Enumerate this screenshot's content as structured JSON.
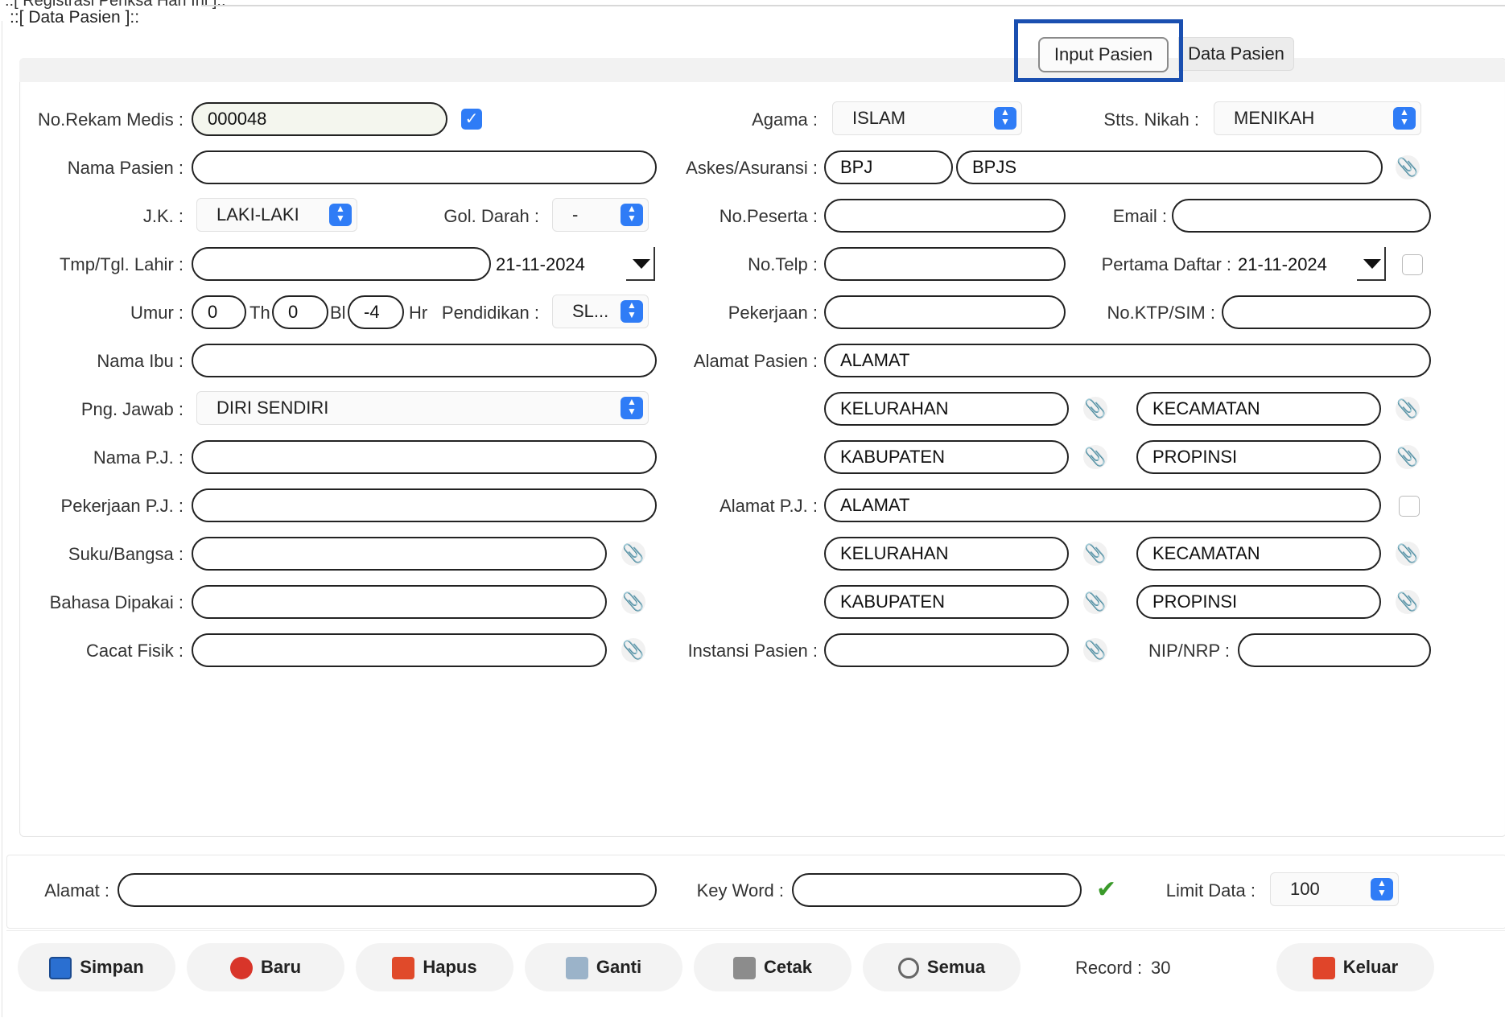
{
  "window": {
    "frame_title": "::[ Registrasi Periksa Hari Ini ]::",
    "section_title": "::[ Data Pasien ]::"
  },
  "tabs": [
    {
      "label": "Input Pasien",
      "active": true
    },
    {
      "label": "Data Pasien",
      "active": false
    }
  ],
  "left": {
    "no_rm_label": "No.Rekam Medis :",
    "no_rm_value": "000048",
    "no_rm_checked": true,
    "nama_label": "Nama Pasien :",
    "nama_value": "",
    "jk_label": "J.K. :",
    "jk_value": "LAKI-LAKI",
    "goldarah_label": "Gol. Darah :",
    "goldarah_value": "-",
    "tmp_label": "Tmp/Tgl. Lahir :",
    "tmp_value": "",
    "tgl_lahir": "21-11-2024",
    "umur_label": "Umur :",
    "umur_th": "0",
    "th_label": "Th",
    "umur_bl": "0",
    "bl_label": "Bl",
    "umur_hr": "-4",
    "hr_label": "Hr",
    "pendidikan_label": "Pendidikan :",
    "pendidikan_value": "SL...",
    "ibu_label": "Nama Ibu :",
    "ibu_value": "",
    "pj_label": "Png. Jawab :",
    "pj_value": "DIRI SENDIRI",
    "namapj_label": "Nama P.J. :",
    "namapj_value": "",
    "pekerjaanpj_label": "Pekerjaan P.J. :",
    "pekerjaanpj_value": "",
    "suku_label": "Suku/Bangsa :",
    "suku_value": "",
    "bahasa_label": "Bahasa Dipakai :",
    "bahasa_value": "",
    "cacat_label": "Cacat Fisik :",
    "cacat_value": ""
  },
  "right": {
    "agama_label": "Agama :",
    "agama_value": "ISLAM",
    "nikah_label": "Stts. Nikah :",
    "nikah_value": "MENIKAH",
    "askes_label": "Askes/Asuransi :",
    "askes_code": "BPJ",
    "askes_name": "BPJS",
    "peserta_label": "No.Peserta :",
    "peserta_value": "",
    "email_label": "Email :",
    "email_value": "",
    "telp_label": "No.Telp :",
    "telp_value": "",
    "daftar_label": "Pertama Daftar :",
    "daftar_value": "21-11-2024",
    "pekerjaan_label": "Pekerjaan :",
    "pekerjaan_value": "",
    "ktp_label": "No.KTP/SIM :",
    "ktp_value": "",
    "alamat_label": "Alamat Pasien :",
    "alamat_value": "ALAMAT",
    "kel1": "KELURAHAN",
    "kec1": "KECAMATAN",
    "kab1": "KABUPATEN",
    "prop1": "PROPINSI",
    "alamatpj_label": "Alamat P.J. :",
    "alamatpj_value": "ALAMAT",
    "kel2": "KELURAHAN",
    "kec2": "KECAMATAN",
    "kab2": "KABUPATEN",
    "prop2": "PROPINSI",
    "instansi_label": "Instansi Pasien :",
    "instansi_value": "",
    "nip_label": "NIP/NRP :",
    "nip_value": ""
  },
  "search": {
    "alamat_label": "Alamat :",
    "alamat_value": "",
    "keyword_label": "Key Word :",
    "keyword_value": "",
    "limit_label": "Limit Data :",
    "limit_value": "100"
  },
  "buttons": {
    "simpan": "Simpan",
    "baru": "Baru",
    "hapus": "Hapus",
    "ganti": "Ganti",
    "cetak": "Cetak",
    "semua": "Semua",
    "keluar": "Keluar",
    "record_label": "Record :",
    "record_value": "30"
  },
  "colors": {
    "accent": "#2f7cf6",
    "highlight": "#1a4fb0"
  }
}
